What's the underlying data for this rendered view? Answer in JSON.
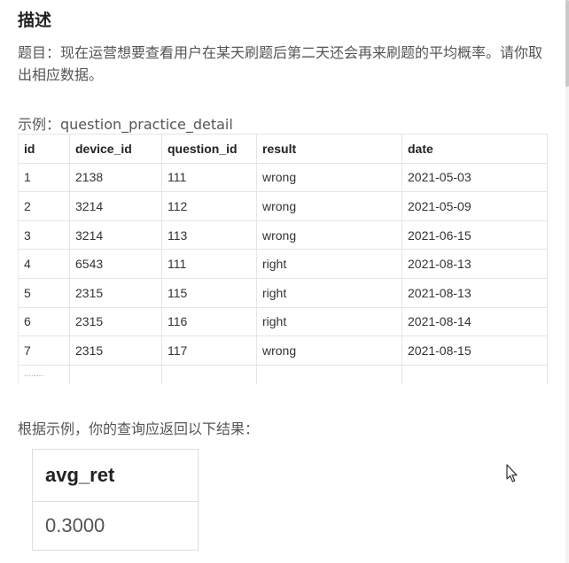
{
  "heading": "描述",
  "description": "题目：现在运营想要查看用户在某天刷题后第二天还会再来刷题的平均概率。请你取出相应数据。",
  "example_label": "示例：question_practice_detail",
  "table": {
    "columns": [
      "id",
      "device_id",
      "question_id",
      "result",
      "date"
    ],
    "rows": [
      [
        "1",
        "2138",
        "111",
        "wrong",
        "2021-05-03"
      ],
      [
        "2",
        "3214",
        "112",
        "wrong",
        "2021-05-09"
      ],
      [
        "3",
        "3214",
        "113",
        "wrong",
        "2021-06-15"
      ],
      [
        "4",
        "6543",
        "111",
        "right",
        "2021-08-13"
      ],
      [
        "5",
        "2315",
        "115",
        "right",
        "2021-08-13"
      ],
      [
        "6",
        "2315",
        "116",
        "right",
        "2021-08-14"
      ],
      [
        "7",
        "2315",
        "117",
        "wrong",
        "2021-08-15"
      ]
    ],
    "ellipsis": "........"
  },
  "result_intro": "根据示例，你的查询应返回以下结果：",
  "result": {
    "column": "avg_ret",
    "value": "0.3000"
  },
  "icons": {
    "cursor": "mouse-pointer-icon"
  }
}
